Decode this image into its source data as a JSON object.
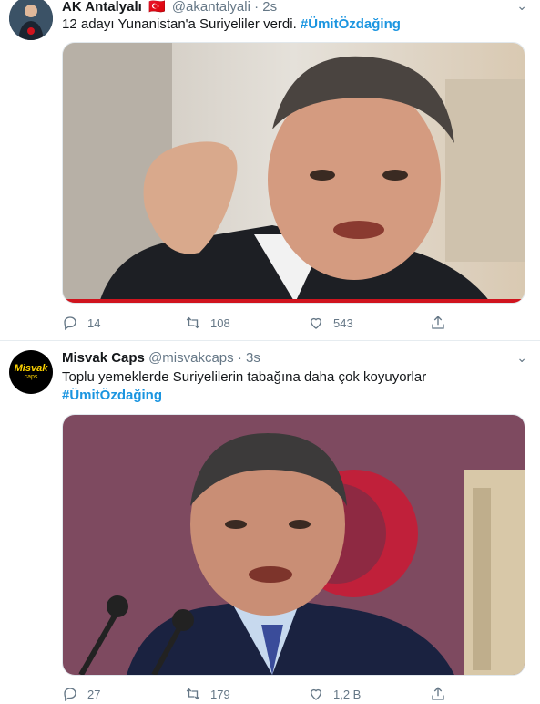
{
  "tweets": [
    {
      "name": "AK Antalyalı",
      "flag": "🇹🇷",
      "handle": "@akantalyali",
      "time": "2s",
      "text": "12 adayı Yunanistan'a Suriyeliler verdi.",
      "hashtag": "#ÜmitÖzdağing",
      "reply_count": "14",
      "retweet_count": "108",
      "like_count": "543"
    },
    {
      "name": "Misvak Caps",
      "handle": "@misvakcaps",
      "time": "3s",
      "text": "Toplu yemeklerde Suriyelilerin tabağına daha çok koyuyorlar",
      "hashtag": "#ÜmitÖzdağing",
      "avatar_text": "Misvak",
      "avatar_subtext": "caps",
      "reply_count": "27",
      "retweet_count": "179",
      "like_count": "1,2 B"
    }
  ],
  "colors": {
    "accent": "#1b95e0",
    "secondary": "#657786",
    "border": "#e6ecf0"
  }
}
